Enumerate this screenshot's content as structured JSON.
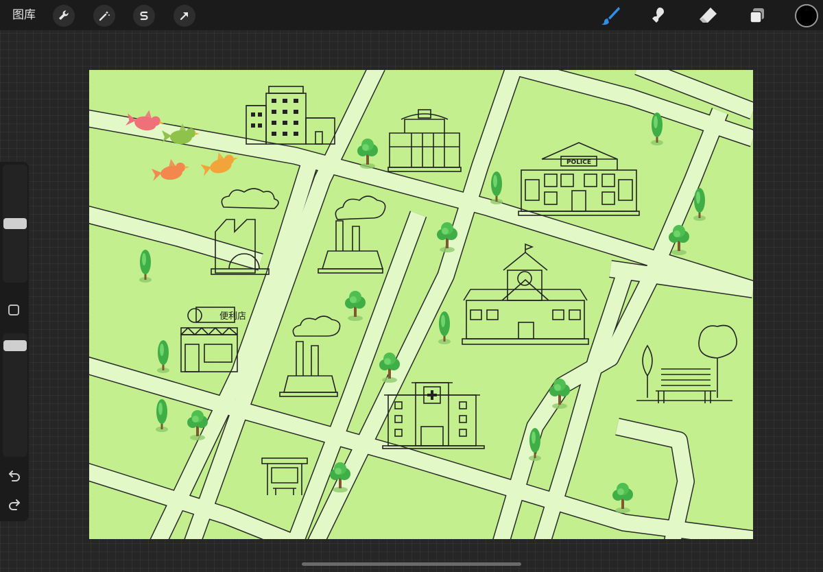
{
  "topbar": {
    "gallery_label": "图库",
    "tools": [
      "wrench-icon",
      "magic-wand-icon",
      "selection-icon",
      "transform-arrow-icon"
    ],
    "right_tools": [
      "brush-icon",
      "smudge-icon",
      "eraser-icon",
      "layers-icon"
    ],
    "active_tool": "brush",
    "active_color": "#000000"
  },
  "sidebar": {
    "brush_size_level": 0.18,
    "opacity_level": 0.95,
    "undo_icon": "undo-icon",
    "redo_icon": "redo-icon"
  },
  "canvas": {
    "background": "#c3ef8e",
    "road_color": "#e2f8c6",
    "labels": {
      "police": "POLICE",
      "store": "便利店"
    },
    "illustrations": [
      "office-building",
      "shopping-mall",
      "police-station",
      "factory",
      "factory",
      "factory",
      "school-clock-tower",
      "convenience-store",
      "hospital",
      "bus-stop",
      "park-bench",
      "trees",
      "birds"
    ]
  }
}
